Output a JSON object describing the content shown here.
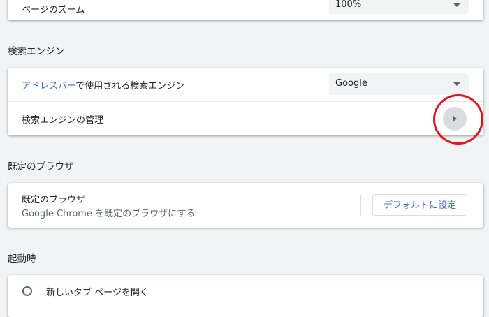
{
  "zoom": {
    "label": "ページのズーム",
    "value": "100%"
  },
  "search_engine": {
    "section_title": "検索エンジン",
    "address_bar_link": "アドレスバー",
    "address_bar_suffix": "で使用される検索エンジン",
    "selected_engine": "Google",
    "manage_label": "検索エンジンの管理"
  },
  "default_browser": {
    "section_title": "既定のブラウザ",
    "title": "既定のブラウザ",
    "subtitle": "Google Chrome を既定のブラウザにする",
    "button_label": "デフォルトに設定"
  },
  "on_startup": {
    "section_title": "起動時",
    "option_new_tab": "新しいタブ ページを開く"
  },
  "colors": {
    "accent": "#3c6fd1",
    "highlight": "#e8121d"
  },
  "icons": [
    "chevron-down-icon",
    "arrow-right-icon",
    "radio-icon"
  ]
}
